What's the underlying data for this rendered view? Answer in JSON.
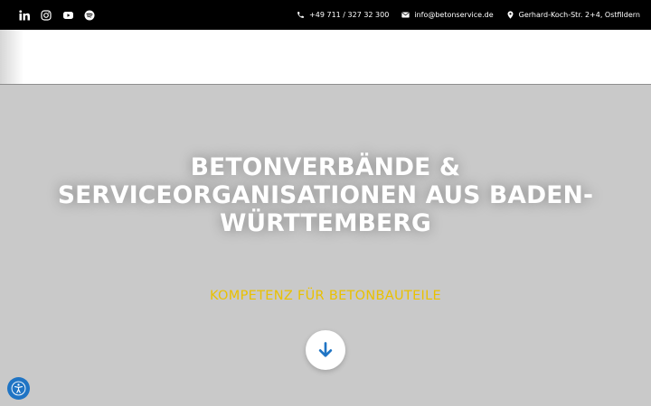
{
  "topbar": {
    "social": [
      {
        "icon": "linkedin-icon"
      },
      {
        "icon": "instagram-icon"
      },
      {
        "icon": "youtube-icon"
      },
      {
        "icon": "spotify-icon"
      }
    ],
    "phone": "+49 711 / 327 32 300",
    "email": "info@betonservice.de",
    "address": "Gerhard-Koch-Str. 2+4, Ostfildern"
  },
  "hero": {
    "title_line1": "BETONVERBÄNDE &",
    "title_line2": "SERVICEORGANISATIONEN AUS BADEN-",
    "title_line3": "WÜRTTEMBERG",
    "subtitle": "KOMPETENZ FÜR BETONBAUTEILE",
    "scroll_icon": "arrow-down-icon"
  },
  "accessibility": {
    "icon": "accessibility-icon"
  },
  "colors": {
    "topbar": "#000000",
    "hero_bg": "#c9c9c9",
    "accent_yellow": "#e9c100",
    "accent_blue": "#1f74c4"
  }
}
